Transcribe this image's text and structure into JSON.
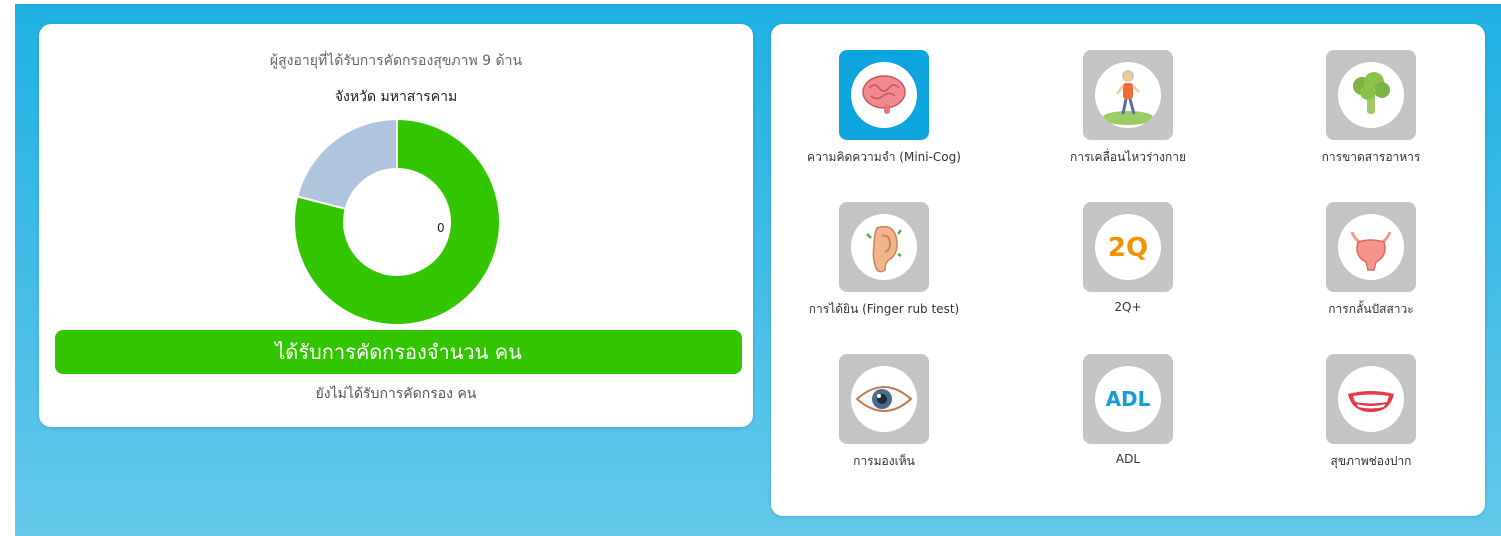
{
  "summary": {
    "title": "ผู้สูงอายุที่ได้รับการคัดกรองสุขภาพ 9 ด้าน",
    "province": "จังหวัด มหาสารคาม",
    "center_value": "0",
    "screened_label": "ได้รับการคัดกรองจำนวน คน",
    "not_screened_label": "ยังไม่ได้รับการคัดกรอง คน"
  },
  "chart_data": {
    "type": "pie",
    "labels": [
      "",
      ""
    ],
    "values": [
      0.79,
      0.21
    ],
    "colors": [
      "#33c600",
      "#b0c4de"
    ]
  },
  "menu": {
    "items": [
      {
        "label": "ความคิดความจำ (Mini-Cog)",
        "icon": "brain-icon",
        "active": true
      },
      {
        "label": "การเคลื่อนไหวร่างกาย",
        "icon": "elderly-walking-icon",
        "active": false
      },
      {
        "label": "การขาดสารอาหาร",
        "icon": "broccoli-icon",
        "active": false
      },
      {
        "label": "การได้ยิน (Finger rub test)",
        "icon": "ear-icon",
        "active": false
      },
      {
        "label": "2Q+",
        "icon": "2q-icon",
        "active": false
      },
      {
        "label": "การกลั้นปัสสาวะ",
        "icon": "bladder-icon",
        "active": false
      },
      {
        "label": "การมองเห็น",
        "icon": "eye-icon",
        "active": false
      },
      {
        "label": "ADL",
        "icon": "adl-icon",
        "active": false
      },
      {
        "label": "สุขภาพช่องปาก",
        "icon": "mouth-icon",
        "active": false
      }
    ],
    "icon_text": {
      "twoq": "2Q",
      "adl": "ADL"
    }
  },
  "colors": {
    "background": "#1fb1e3",
    "screened": "#33c600",
    "not_screened": "#b0c4de",
    "active_tile": "#0ea5df",
    "inactive_tile": "#c4c4c4"
  }
}
